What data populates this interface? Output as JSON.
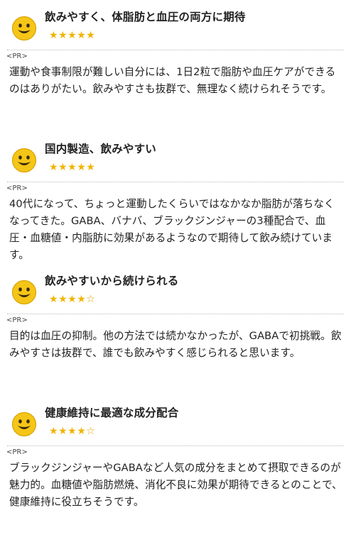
{
  "reviews": [
    {
      "title": "飲みやすく、体脂肪と血圧の両方に期待",
      "rating": 5,
      "pr_label": "<PR>",
      "body": "運動や食事制限が難しい自分には、1日2粒で脂肪や血圧ケアができるのはありがたい。飲みやすさも抜群で、無理なく続けられそうです。"
    },
    {
      "title": "国内製造、飲みやすい",
      "rating": 5,
      "pr_label": "<PR>",
      "body": "40代になって、ちょっと運動したくらいではなかなか脂肪が落ちなくなってきた。GABA、バナバ、ブラックジンジャーの3種配合で、血圧・血糖値・内脂肪に効果があるようなので期待して飲み続けています。"
    },
    {
      "title": "飲みやすいから続けられる",
      "rating": 4,
      "pr_label": "<PR>",
      "body": "目的は血圧の抑制。他の方法では続かなかったが、GABAで初挑戦。飲みやすさは抜群で、誰でも飲みやすく感じられると思います。"
    },
    {
      "title": "健康維持に最適な成分配合",
      "rating": 4,
      "pr_label": "<PR>",
      "body": "ブラックジンジャーやGABAなど人気の成分をまとめて摂取できるのが魅力的。血糖値や脂肪燃焼、消化不良に効果が期待できるとのことで、健康維持に役立ちそうです。"
    }
  ],
  "rating_max": 5,
  "icons": {
    "avatar": "smiley-face-icon",
    "star": "star-icon"
  },
  "colors": {
    "face": "#f5c518",
    "face_outline": "#d9a400",
    "star": "#f0b400",
    "divider": "#bbbbbb"
  }
}
